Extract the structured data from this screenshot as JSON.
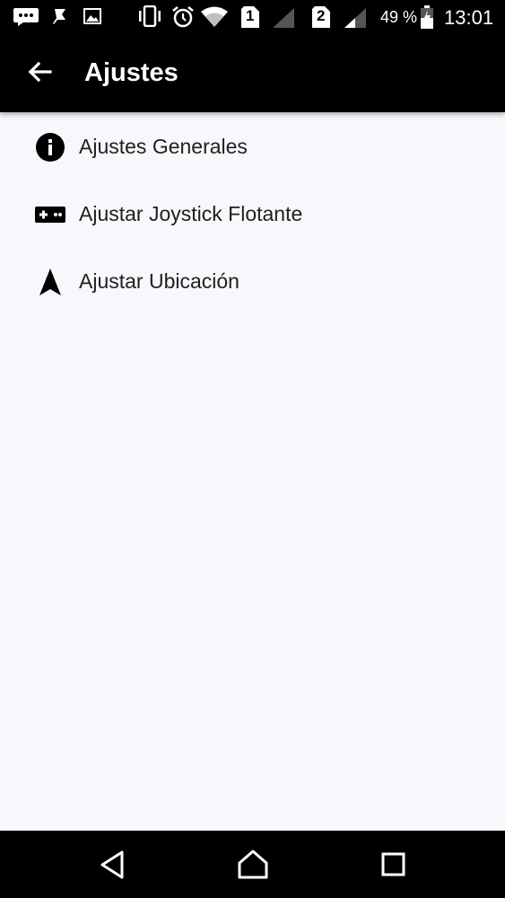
{
  "status_bar": {
    "sim1": "1",
    "sim2": "2",
    "battery": "49 %",
    "time": "13:01",
    "icons": [
      "chat-icon",
      "pin-icon",
      "image-icon",
      "vibrate-icon",
      "alarm-icon",
      "wifi-icon",
      "signal-icon",
      "signal-icon",
      "battery-icon"
    ]
  },
  "app_bar": {
    "title": "Ajustes",
    "back_icon": "arrow-back-icon"
  },
  "settings": {
    "items": [
      {
        "label": "Ajustes Generales",
        "icon": "info-icon"
      },
      {
        "label": "Ajustar Joystick Flotante",
        "icon": "gamepad-icon"
      },
      {
        "label": "Ajustar Ubicación",
        "icon": "navigation-icon"
      }
    ]
  },
  "nav_bar": {
    "buttons": [
      "back-triangle-icon",
      "home-icon",
      "recents-icon"
    ]
  },
  "colors": {
    "bars": "#000000",
    "background": "#f8f7fb",
    "text": "#202020"
  }
}
